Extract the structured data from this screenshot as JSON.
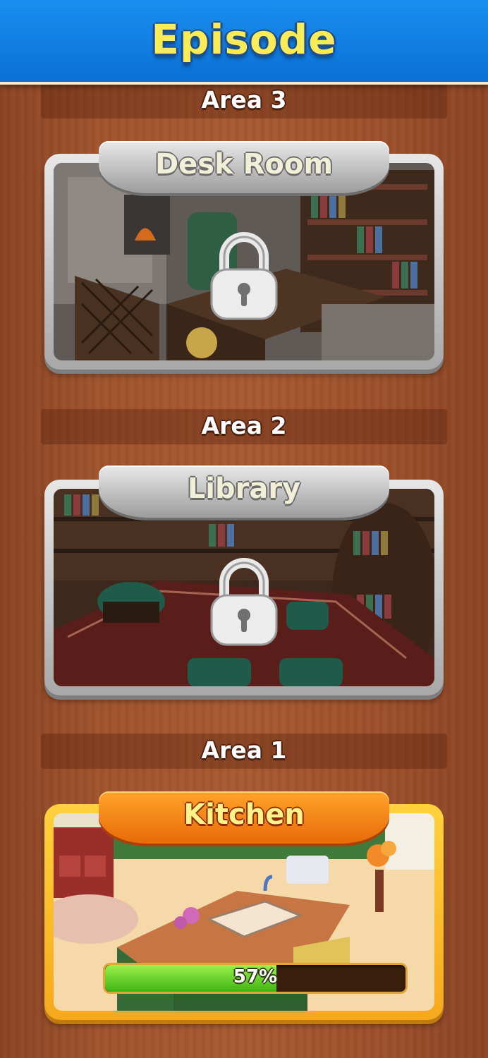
{
  "header": {
    "title": "Episode"
  },
  "areas": [
    {
      "area_label": "Area 3",
      "room_name": "Desk Room",
      "status": "locked"
    },
    {
      "area_label": "Area 2",
      "room_name": "Library",
      "status": "locked"
    },
    {
      "area_label": "Area 1",
      "room_name": "Kitchen",
      "status": "unlocked",
      "progress_text": "57%",
      "progress_value": 57
    }
  ],
  "colors": {
    "header_blue": "#0a70d6",
    "title_yellow": "#f9ec58",
    "locked_frame": "#b5b5b5",
    "active_frame": "#f6a81d",
    "progress_green": "#3fb414"
  },
  "icons": {
    "lock": "padlock-icon"
  }
}
